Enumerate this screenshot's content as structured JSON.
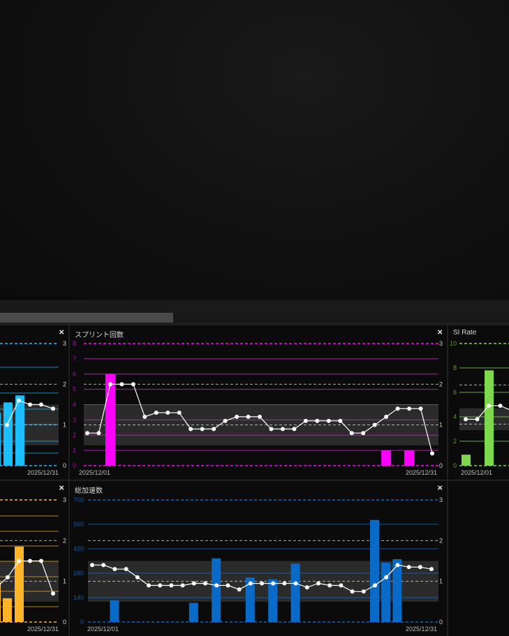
{
  "panels": {
    "left_top": {
      "title": "",
      "close": "×",
      "right_ticks": [
        "3",
        "2",
        "1",
        "0"
      ],
      "date_end": "2025/12/31"
    },
    "sprint": {
      "title": "スプリント回数",
      "close": "×",
      "left_ticks": [
        "8",
        "7",
        "6",
        "5",
        "4",
        "3",
        "2",
        "1",
        "0"
      ],
      "right_ticks": [
        "3",
        "2",
        "1",
        "0"
      ],
      "date_start": "2025/12/01",
      "date_end": "2025/12/31"
    },
    "si_rate": {
      "title": "SI Rate",
      "left_ticks": [
        "10",
        "8",
        "6",
        "4",
        "2",
        "0"
      ],
      "date_start": "2025/12/01"
    },
    "left_bottom": {
      "title": "",
      "close": "×",
      "right_ticks": [
        "3",
        "2",
        "1",
        "0"
      ],
      "date_end": "2025/12/31"
    },
    "accel": {
      "title": "総加速数",
      "close": "×",
      "left_ticks": [
        "700",
        "560",
        "420",
        "280",
        "140",
        "0"
      ],
      "right_ticks": [
        "3",
        "2",
        "1",
        "0"
      ],
      "date_start": "2025/12/01",
      "date_end": "2025/12/31"
    }
  },
  "colors": {
    "cyan": "#1bbfff",
    "magenta": "#ff00ff",
    "green": "#7ed84c",
    "orange": "#ffb327",
    "blue": "#0a6ac8"
  },
  "chart_data": [
    {
      "type": "bar",
      "panel": "left_top",
      "x_days": [
        29,
        30
      ],
      "bar_values": [
        1.8,
        2.0
      ],
      "line_values": [
        1.0,
        1.6,
        1.5,
        1.5,
        1.4
      ],
      "left_ylim": [
        0,
        8
      ],
      "right_ylim": [
        0,
        3
      ]
    },
    {
      "type": "bar",
      "panel": "sprint",
      "x_range": [
        1,
        31
      ],
      "bar_days": [
        3,
        27,
        29
      ],
      "bar_values": [
        6,
        1,
        1
      ],
      "line_values": [
        0.8,
        0.8,
        2.0,
        2.0,
        2.0,
        1.2,
        1.3,
        1.3,
        1.3,
        0.9,
        0.9,
        0.9,
        1.1,
        1.2,
        1.2,
        1.2,
        0.9,
        0.9,
        0.9,
        1.1,
        1.1,
        1.1,
        1.1,
        0.8,
        0.8,
        1.0,
        1.2,
        1.4,
        1.4,
        1.4,
        0.3
      ],
      "left_ylim": [
        0,
        8
      ],
      "right_ylim": [
        0,
        3
      ]
    },
    {
      "type": "bar",
      "panel": "si_rate",
      "x_days": [
        1,
        2,
        3,
        4,
        5
      ],
      "bar_days": [
        1,
        3
      ],
      "bar_values": [
        0.9,
        7.8
      ],
      "line_values": [
        3.8,
        3.8,
        4.9,
        4.9,
        4.5
      ],
      "left_ylim": [
        0,
        10
      ]
    },
    {
      "type": "bar",
      "panel": "left_bottom",
      "x_days": [
        25,
        26,
        27,
        28,
        29,
        30,
        31
      ],
      "bar_days": [
        25,
        26,
        27
      ],
      "bar_values": [
        2.0,
        1.2,
        3.8
      ],
      "line_values": [
        0.9,
        1.1,
        1.5,
        1.5,
        1.5,
        0.7
      ],
      "left_ylim": [
        0,
        8
      ],
      "right_ylim": [
        0,
        3
      ]
    },
    {
      "type": "bar",
      "panel": "accel",
      "x_range": [
        1,
        31
      ],
      "bar_days": [
        3,
        10,
        12,
        15,
        17,
        19,
        26,
        27,
        28
      ],
      "bar_values": [
        125,
        110,
        365,
        255,
        245,
        335,
        585,
        340,
        360
      ],
      "line_values": [
        1.4,
        1.4,
        1.3,
        1.3,
        1.1,
        0.9,
        0.9,
        0.9,
        0.9,
        0.95,
        0.95,
        0.9,
        0.9,
        0.8,
        0.95,
        0.95,
        0.95,
        0.95,
        0.95,
        0.85,
        0.95,
        0.9,
        0.9,
        0.75,
        0.75,
        0.9,
        1.1,
        1.4,
        1.35,
        1.35,
        1.3
      ],
      "left_ylim": [
        0,
        700
      ],
      "right_ylim": [
        0,
        3
      ]
    }
  ]
}
